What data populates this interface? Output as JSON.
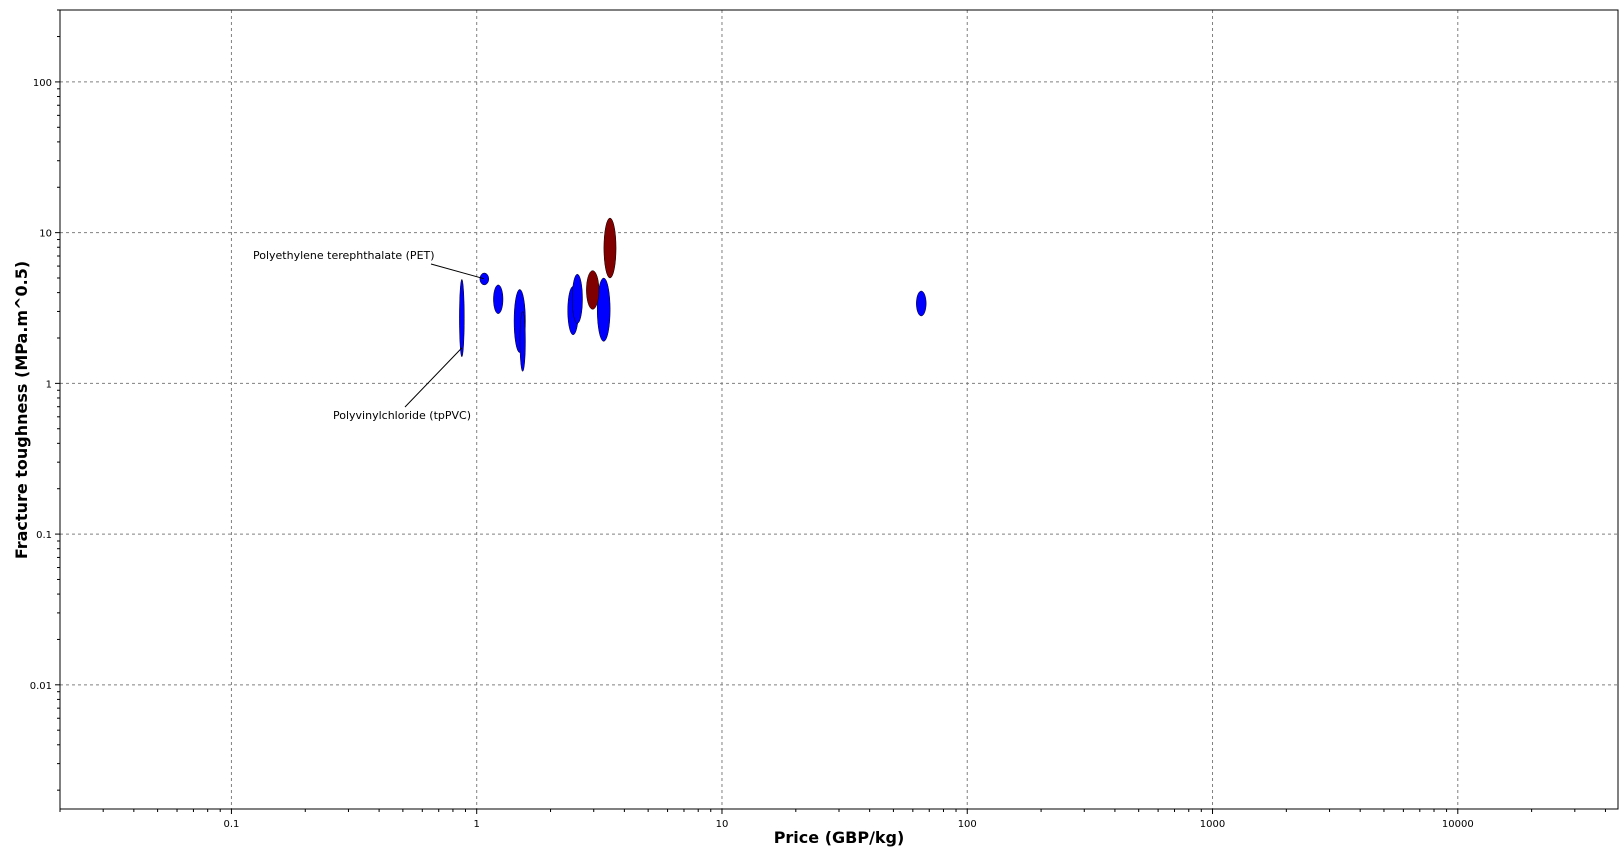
{
  "chart_data": {
    "type": "scatter",
    "title": "",
    "xlabel": "Price (GBP/kg)",
    "ylabel": "Fracture toughness (MPa.m^0.5)",
    "x_scale": "log",
    "y_scale": "log",
    "xlim": [
      0.02,
      45000
    ],
    "ylim": [
      0.0015,
      300
    ],
    "grid": true,
    "x_ticks": [
      {
        "value": 0.1,
        "label": "0.1"
      },
      {
        "value": 1,
        "label": "1"
      },
      {
        "value": 10,
        "label": "10"
      },
      {
        "value": 100,
        "label": "100"
      },
      {
        "value": 1000,
        "label": "1000"
      },
      {
        "value": 10000,
        "label": "10000"
      }
    ],
    "y_ticks": [
      {
        "value": 0.01,
        "label": "0.01"
      },
      {
        "value": 0.1,
        "label": "0.1"
      },
      {
        "value": 1,
        "label": "1"
      },
      {
        "value": 10,
        "label": "10"
      },
      {
        "value": 100,
        "label": "100"
      }
    ],
    "colors": {
      "blue": "#0000ff",
      "red": "#800000"
    },
    "bubbles": [
      {
        "x_min": 0.85,
        "x_max": 0.89,
        "y_min": 1.5,
        "y_max": 4.9,
        "color": "blue"
      },
      {
        "x_min": 1.03,
        "x_max": 1.12,
        "y_min": 4.5,
        "y_max": 5.4,
        "color": "blue"
      },
      {
        "x_min": 1.17,
        "x_max": 1.28,
        "y_min": 2.9,
        "y_max": 4.5,
        "color": "blue"
      },
      {
        "x_min": 1.42,
        "x_max": 1.58,
        "y_min": 1.6,
        "y_max": 4.2,
        "color": "blue"
      },
      {
        "x_min": 1.5,
        "x_max": 1.58,
        "y_min": 1.2,
        "y_max": 3.0,
        "color": "blue"
      },
      {
        "x_min": 2.35,
        "x_max": 2.6,
        "y_min": 2.1,
        "y_max": 4.4,
        "color": "blue"
      },
      {
        "x_min": 2.45,
        "x_max": 2.7,
        "y_min": 2.5,
        "y_max": 5.3,
        "color": "blue"
      },
      {
        "x_min": 3.1,
        "x_max": 3.5,
        "y_min": 1.9,
        "y_max": 5.0,
        "color": "blue"
      },
      {
        "x_min": 62,
        "x_max": 68,
        "y_min": 2.8,
        "y_max": 4.1,
        "color": "blue"
      },
      {
        "x_min": 2.8,
        "x_max": 3.15,
        "y_min": 3.1,
        "y_max": 5.6,
        "color": "red"
      },
      {
        "x_min": 3.3,
        "x_max": 3.7,
        "y_min": 5.0,
        "y_max": 12.5,
        "color": "red"
      }
    ],
    "annotations": [
      {
        "text": "Polyethylene terephthalate (PET)",
        "x": 1.07,
        "y": 4.95
      },
      {
        "text": "Polyvinylchloride (tpPVC)",
        "x": 0.87,
        "y": 1.72
      }
    ]
  }
}
